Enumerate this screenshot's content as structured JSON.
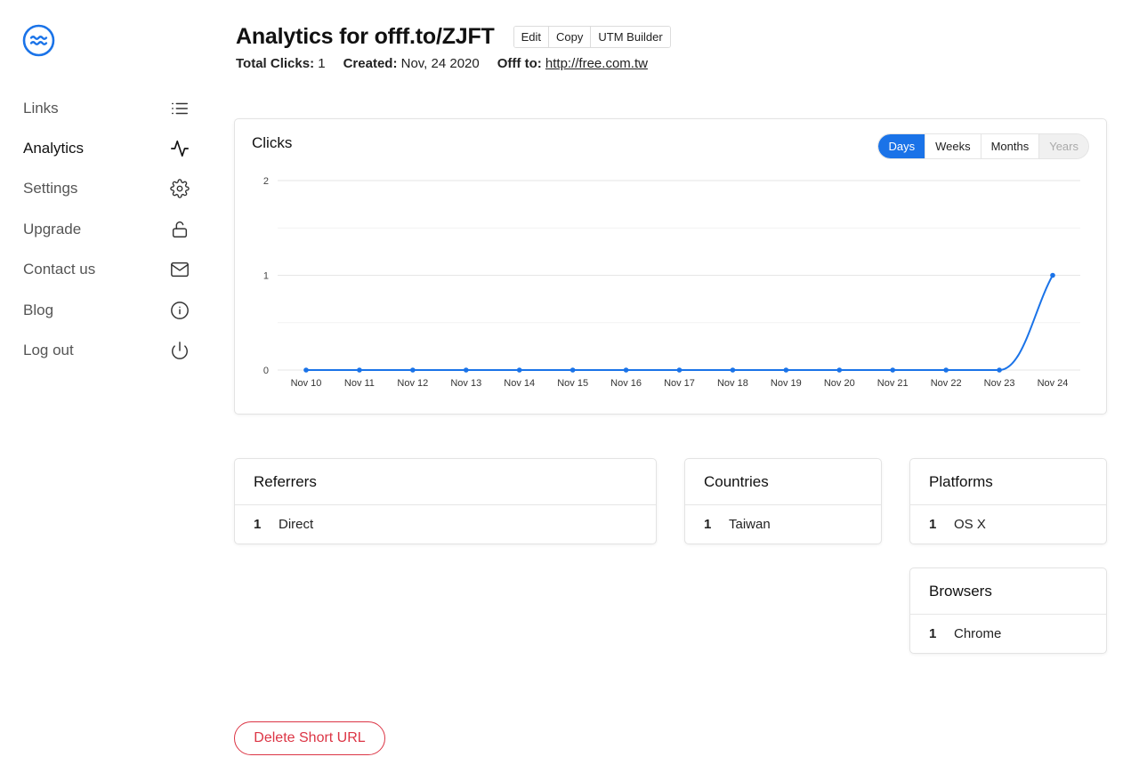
{
  "sidebar": {
    "items": [
      {
        "label": "Links",
        "icon": "list-icon"
      },
      {
        "label": "Analytics",
        "icon": "activity-icon",
        "active": true
      },
      {
        "label": "Settings",
        "icon": "gear-icon"
      },
      {
        "label": "Upgrade",
        "icon": "unlock-icon"
      },
      {
        "label": "Contact us",
        "icon": "mail-icon"
      },
      {
        "label": "Blog",
        "icon": "info-icon"
      },
      {
        "label": "Log out",
        "icon": "power-icon"
      }
    ]
  },
  "header": {
    "title": "Analytics for offf.to/ZJFT",
    "actions": {
      "edit": "Edit",
      "copy": "Copy",
      "utm": "UTM Builder"
    },
    "total_clicks_label": "Total Clicks:",
    "total_clicks_value": "1",
    "created_label": "Created:",
    "created_value": "Nov, 24 2020",
    "offf_to_label": "Offf to:",
    "offf_to_value": "http://free.com.tw"
  },
  "clicks_card": {
    "title": "Clicks",
    "periods": {
      "days": "Days",
      "weeks": "Weeks",
      "months": "Months",
      "years": "Years"
    },
    "selected_period": "Days"
  },
  "chart_data": {
    "type": "line",
    "title": "Clicks",
    "categories": [
      "Nov 10",
      "Nov 11",
      "Nov 12",
      "Nov 13",
      "Nov 14",
      "Nov 15",
      "Nov 16",
      "Nov 17",
      "Nov 18",
      "Nov 19",
      "Nov 20",
      "Nov 21",
      "Nov 22",
      "Nov 23",
      "Nov 24"
    ],
    "values": [
      0,
      0,
      0,
      0,
      0,
      0,
      0,
      0,
      0,
      0,
      0,
      0,
      0,
      0,
      1
    ],
    "ylim": [
      0,
      2
    ],
    "yticks": [
      "0",
      "1",
      "2"
    ],
    "grid": true,
    "color": "#1a73e8"
  },
  "referrers": {
    "title": "Referrers",
    "rows": [
      {
        "count": "1",
        "label": "Direct"
      }
    ]
  },
  "countries": {
    "title": "Countries",
    "rows": [
      {
        "count": "1",
        "label": "Taiwan"
      }
    ]
  },
  "platforms": {
    "title": "Platforms",
    "rows": [
      {
        "count": "1",
        "label": "OS X"
      }
    ]
  },
  "browsers": {
    "title": "Browsers",
    "rows": [
      {
        "count": "1",
        "label": "Chrome"
      }
    ]
  },
  "delete_label": "Delete Short URL",
  "colors": {
    "accent": "#1a73e8",
    "danger": "#dc3545"
  }
}
